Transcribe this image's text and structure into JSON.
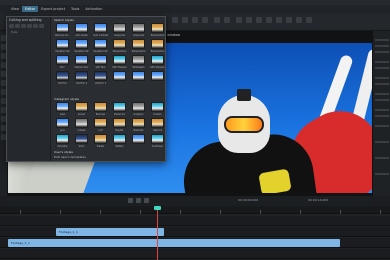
{
  "menu": {
    "items": [
      "",
      "View",
      "Editor",
      "Export project",
      "Tools",
      "Activation"
    ],
    "active_index": 2
  },
  "toolbar": {
    "buttons": [
      "Cut",
      "Copy",
      "Paste",
      "Delete",
      "Undo",
      "Redo",
      "Add",
      "Text",
      "Filter",
      "Crop",
      "Zoom",
      "Color",
      "Speed",
      "Mask"
    ],
    "zoom_label": "To fit window"
  },
  "popup": {
    "header": "Cutting and splitting",
    "tools_label": "Tools",
    "section1_title": "Sketch styles",
    "section1_thumbs": [
      {
        "caption": "Remove wh...",
        "style": "blue"
      },
      {
        "caption": "Auto levels",
        "style": "blue"
      },
      {
        "caption": "Auto contrast",
        "style": "blue"
      },
      {
        "caption": "Grayscale",
        "style": "gray"
      },
      {
        "caption": "Grayscale",
        "style": "gray"
      },
      {
        "caption": "Temperature",
        "style": "warm"
      },
      {
        "caption": "Equalize hist",
        "style": "blue"
      },
      {
        "caption": "Equalize hist",
        "style": "blue"
      },
      {
        "caption": "Equalize hist",
        "style": "blue"
      },
      {
        "caption": "Temperature",
        "style": "warm"
      },
      {
        "caption": "Temperature",
        "style": "warm"
      },
      {
        "caption": "Temperature",
        "style": "warm"
      },
      {
        "caption": "Blur",
        "style": "blue"
      },
      {
        "caption": "Medium blur",
        "style": "blue"
      },
      {
        "caption": "GPU Blur",
        "style": "blue"
      },
      {
        "caption": "GPU Sharpen",
        "style": "cyan"
      },
      {
        "caption": "Whitewash",
        "style": "gray"
      },
      {
        "caption": "GPU Sharpen",
        "style": "cyan"
      },
      {
        "caption": "Old Film",
        "style": "dark"
      },
      {
        "caption": "Old Film 2",
        "style": "dark"
      },
      {
        "caption": "Old Film 3",
        "style": "dark"
      },
      {
        "caption": "",
        "style": "blue"
      },
      {
        "caption": "",
        "style": "blue"
      },
      {
        "caption": "",
        "style": "blue"
      }
    ],
    "section2_title": "Instagram styles",
    "section2_thumbs": [
      {
        "caption": "Aden",
        "style": "blue"
      },
      {
        "caption": "Amaro",
        "style": "warm"
      },
      {
        "caption": "Brannan",
        "style": "warm"
      },
      {
        "caption": "Clarendon",
        "style": "cyan"
      },
      {
        "caption": "Gingham",
        "style": "gray"
      },
      {
        "caption": "Hudson",
        "style": "cyan"
      },
      {
        "caption": "Juno",
        "style": "blue"
      },
      {
        "caption": "Inkwell",
        "style": "gray"
      },
      {
        "caption": "Lofi",
        "style": "warm"
      },
      {
        "caption": "Mayfair",
        "style": "warm"
      },
      {
        "caption": "Nashville",
        "style": "warm"
      },
      {
        "caption": "Valencia",
        "style": "warm"
      },
      {
        "caption": "Perpetua",
        "style": "cyan"
      },
      {
        "caption": "Sutro",
        "style": "dark"
      },
      {
        "caption": "Toaster",
        "style": "warm"
      },
      {
        "caption": "Walden",
        "style": "cyan"
      },
      {
        "caption": "",
        "style": "blue"
      },
      {
        "caption": "Sunflower",
        "style": "cyan"
      }
    ],
    "section3_title": "User's styles",
    "footer_link": "Edit user's templates"
  },
  "transport": {
    "time_left": "00:00:00.000",
    "time_right": "00:00:14.000"
  },
  "timeline": {
    "clips": [
      {
        "label": "Footage_1_1",
        "track": 0
      },
      {
        "label": "Footage_1_1",
        "track": 1
      }
    ]
  },
  "colors": {
    "accent": "#3b6c8a",
    "clip": "#7fb6e6",
    "playhead": "#e04545",
    "playhead_top": "#3dd7c2"
  }
}
